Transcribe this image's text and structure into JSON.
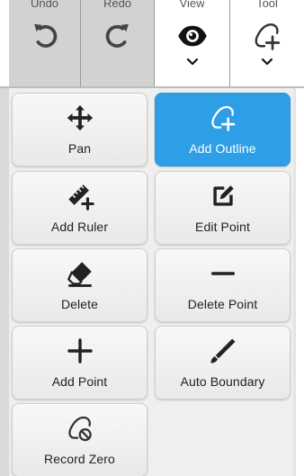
{
  "toolbar": {
    "undo_label": "Undo",
    "redo_label": "Redo",
    "view_label": "View",
    "tool_label": "Tool"
  },
  "tools": {
    "pan": "Pan",
    "add_outline": "Add Outline",
    "add_ruler": "Add Ruler",
    "edit_point": "Edit Point",
    "delete": "Delete",
    "delete_point": "Delete Point",
    "add_point": "Add Point",
    "auto_boundary": "Auto Boundary",
    "record_zero": "Record Zero"
  },
  "active_tool": "Add Outline",
  "colors": {
    "accent": "#2e9fe6",
    "toolbar_gray": "#d2d2d2",
    "panel_bg": "#efefef",
    "icon_dark": "#222222"
  }
}
